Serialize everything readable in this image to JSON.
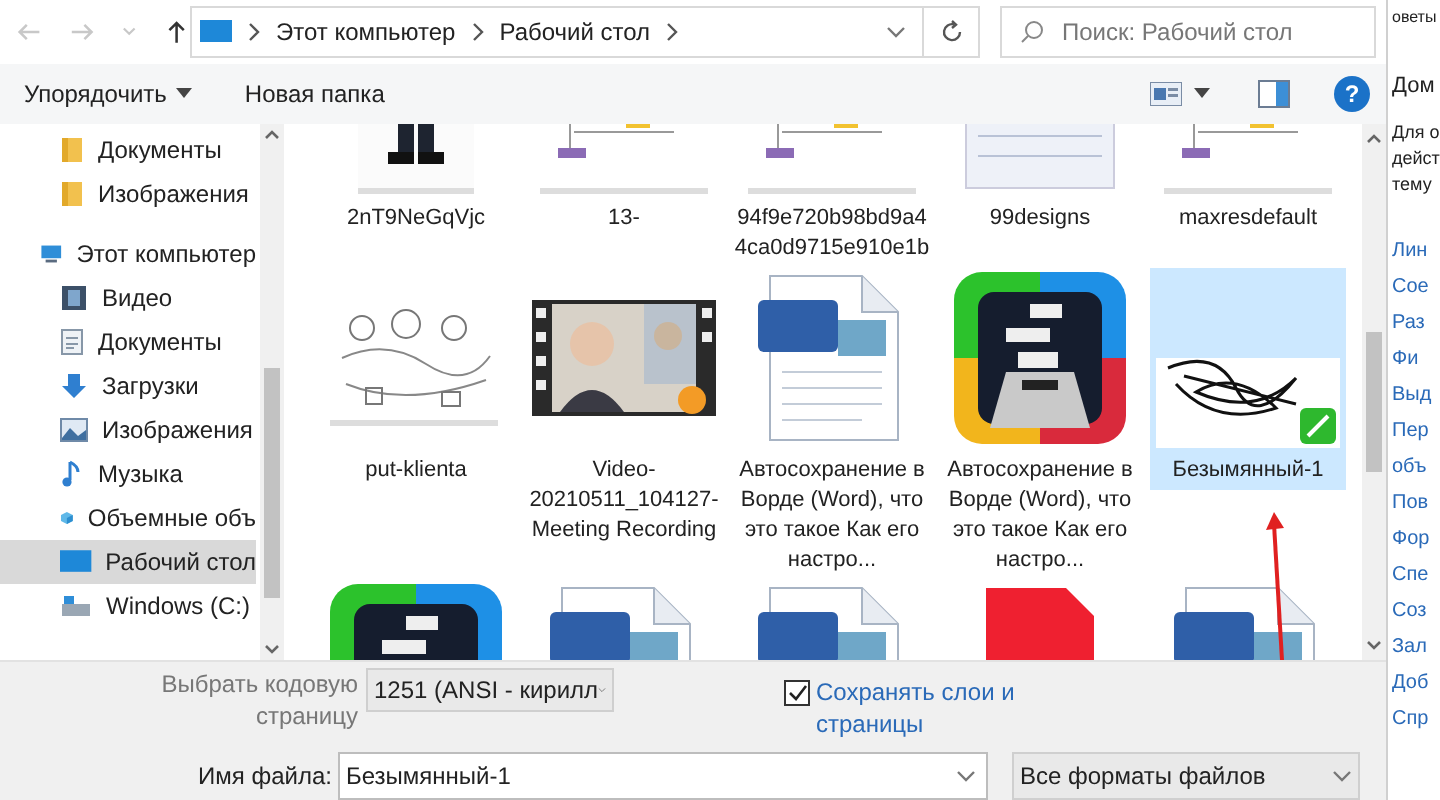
{
  "nav": {
    "back": {
      "disabled": true
    },
    "forward": {
      "disabled": true
    },
    "up": {
      "disabled": false
    }
  },
  "address": {
    "crumbs": [
      "Этот компьютер",
      "Рабочий стол"
    ]
  },
  "search": {
    "placeholder": "Поиск: Рабочий стол"
  },
  "toolbar": {
    "organize": "Упорядочить",
    "new_folder": "Новая папка",
    "help": "?"
  },
  "sidebar": {
    "items": [
      {
        "label": "Документы",
        "kind": "folder",
        "selected": false
      },
      {
        "label": "Изображения",
        "kind": "folder",
        "selected": false
      },
      {
        "label": "Этот компьютер",
        "kind": "computer",
        "selected": false,
        "children": [
          {
            "label": "Видео",
            "kind": "video",
            "selected": false
          },
          {
            "label": "Документы",
            "kind": "documents",
            "selected": false
          },
          {
            "label": "Загрузки",
            "kind": "downloads",
            "selected": false
          },
          {
            "label": "Изображения",
            "kind": "images",
            "selected": false
          },
          {
            "label": "Музыка",
            "kind": "music",
            "selected": false
          },
          {
            "label": "Объемные объ",
            "kind": "objects",
            "selected": false
          },
          {
            "label": "Рабочий стол",
            "kind": "desktop",
            "selected": true
          },
          {
            "label": "Windows (C:)",
            "kind": "drive",
            "selected": false
          }
        ]
      }
    ]
  },
  "files": [
    {
      "label": "2nT9NeGqVjc",
      "kind": "figure",
      "selected": false
    },
    {
      "label": "13-",
      "kind": "diagram",
      "selected": false
    },
    {
      "label": "94f9e720b98bd9a44ca0d9715e910e1b",
      "kind": "diagram",
      "selected": false
    },
    {
      "label": "99designs",
      "kind": "document",
      "selected": false
    },
    {
      "label": "maxresdefault",
      "kind": "diagram",
      "selected": false
    },
    {
      "label": "put-klienta",
      "kind": "sketch",
      "selected": false
    },
    {
      "label": "Video-20210511_104127-Meeting Recording",
      "kind": "video",
      "selected": false
    },
    {
      "label": "Автосохранение в Ворде (Word), что это такое Как его настро...",
      "kind": "word",
      "selected": false
    },
    {
      "label": "Автосохранение в Ворде (Word), что это такое Как его настро...",
      "kind": "app",
      "selected": false
    },
    {
      "label": "Безымянный-1",
      "kind": "drawing",
      "selected": true
    },
    {
      "kind": "app",
      "selected": false
    },
    {
      "kind": "word",
      "selected": false
    },
    {
      "kind": "word",
      "selected": false
    },
    {
      "kind": "red",
      "selected": false
    },
    {
      "kind": "word",
      "selected": false
    }
  ],
  "codepage": {
    "label": "Выбрать кодовую страницу",
    "value": "1251  (ANSI - кирилл"
  },
  "save_layers": {
    "label": "Сохранять слои и страницы",
    "checked": true
  },
  "file_name": {
    "label": "Имя файла:",
    "value": "Безымянный-1"
  },
  "file_type": {
    "value": "Все форматы файлов"
  },
  "help_pane": {
    "top": "оветы",
    "title": "Дом",
    "text_lines": [
      "Для о",
      "дейст",
      "тему"
    ],
    "links": [
      "Лин",
      "Сое",
      "Раз",
      "Фи",
      "Выд",
      "Пер",
      "объ",
      "Пов",
      "Фор",
      "Спе",
      "Соз",
      "Зал",
      "Доб",
      "Спр"
    ]
  }
}
